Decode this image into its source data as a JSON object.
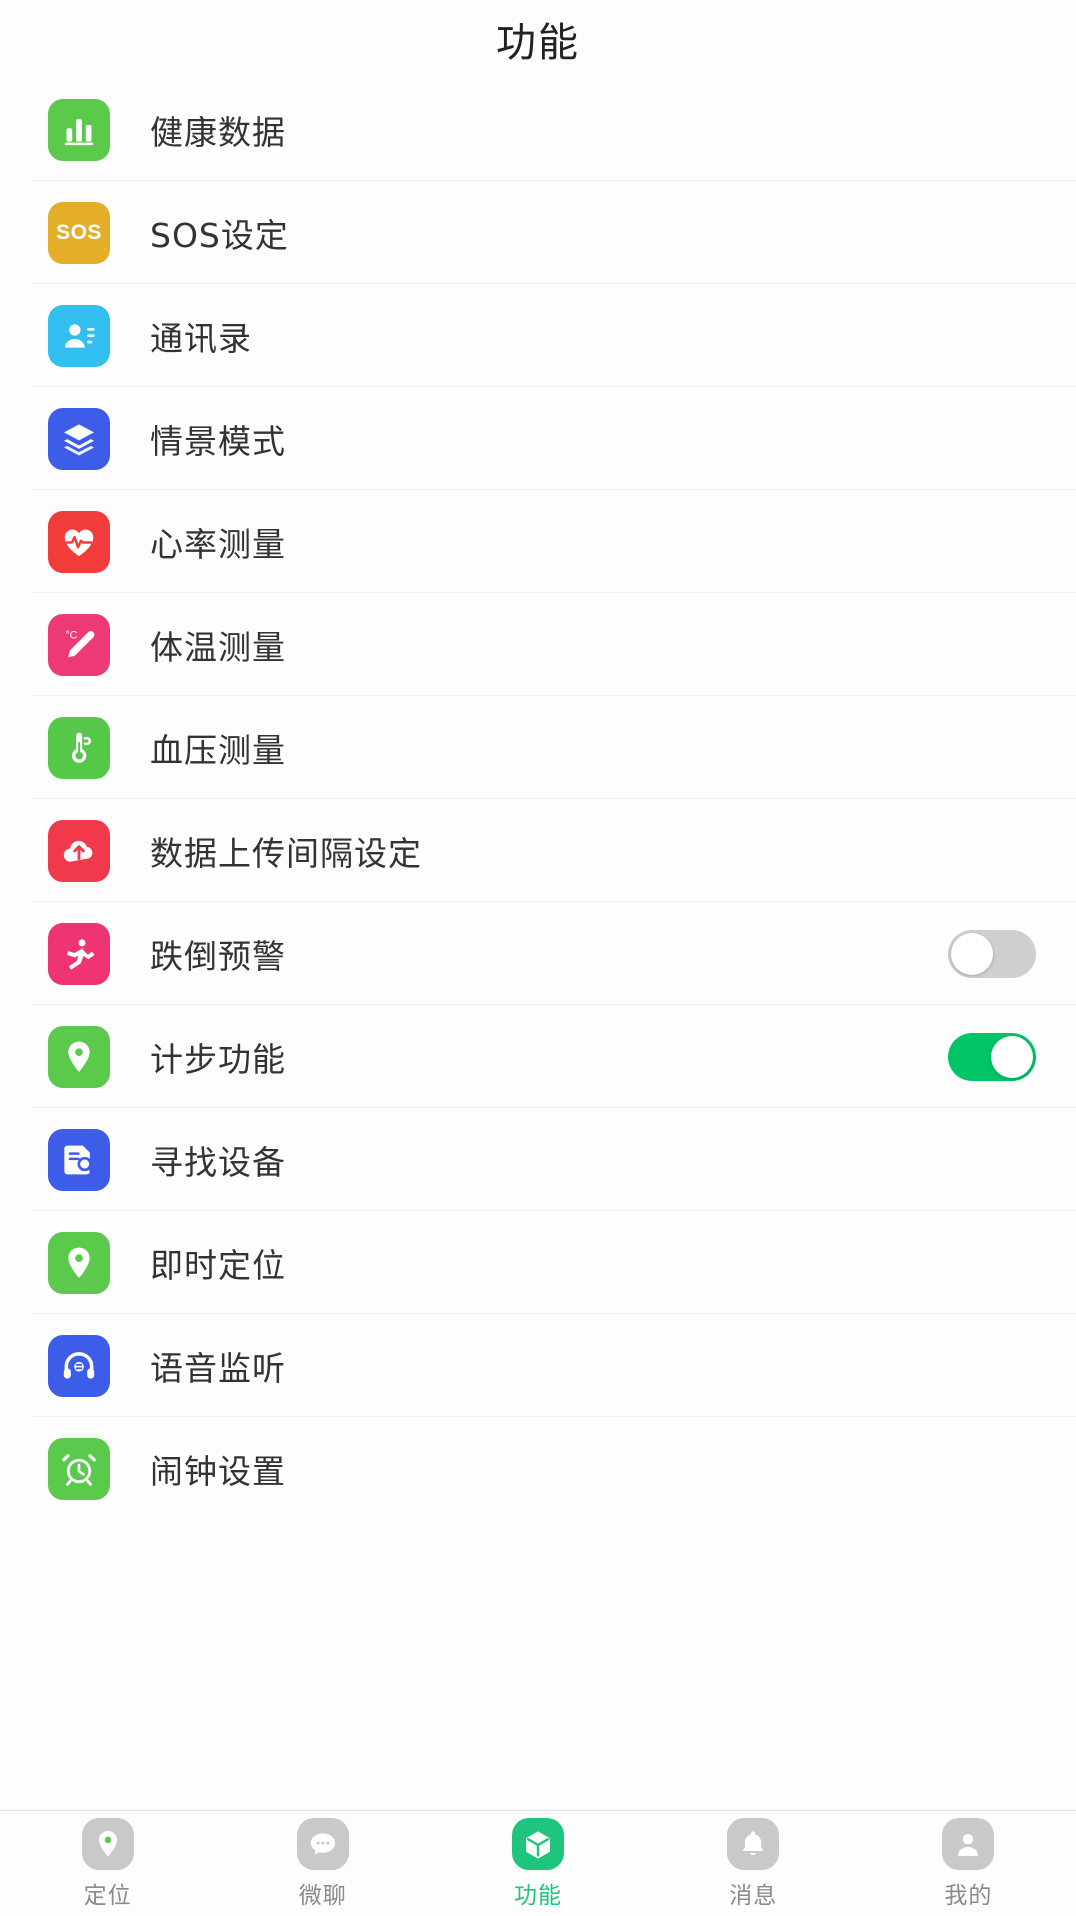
{
  "header": {
    "title": "功能"
  },
  "list": {
    "items": [
      {
        "label": "健康数据",
        "icon": "bar-chart-icon",
        "color": "#5BC94C",
        "control": "none"
      },
      {
        "label": "SOS设定",
        "icon": "sos-icon",
        "color": "#E3AE28",
        "control": "none"
      },
      {
        "label": "通讯录",
        "icon": "contacts-icon",
        "color": "#33BEF0",
        "control": "none"
      },
      {
        "label": "情景模式",
        "icon": "layers-icon",
        "color": "#3D5CE8",
        "control": "none"
      },
      {
        "label": "心率测量",
        "icon": "heart-rate-icon",
        "color": "#F23B3B",
        "control": "none"
      },
      {
        "label": "体温测量",
        "icon": "thermometer-pen-icon",
        "color": "#ED3A75",
        "control": "none"
      },
      {
        "label": "血压测量",
        "icon": "blood-pressure-icon",
        "color": "#55C84A",
        "control": "none"
      },
      {
        "label": "数据上传间隔设定",
        "icon": "cloud-upload-icon",
        "color": "#F03A4B",
        "control": "none"
      },
      {
        "label": "跌倒预警",
        "icon": "fall-alert-icon",
        "color": "#EE3572",
        "control": "toggle",
        "on": false
      },
      {
        "label": "计步功能",
        "icon": "pedometer-icon",
        "color": "#5BC94C",
        "control": "toggle",
        "on": true
      },
      {
        "label": "寻找设备",
        "icon": "find-device-icon",
        "color": "#3D5CE8",
        "control": "none"
      },
      {
        "label": "即时定位",
        "icon": "location-pin-icon",
        "color": "#5BC94C",
        "control": "none"
      },
      {
        "label": "语音监听",
        "icon": "headphones-icon",
        "color": "#3D5CE8",
        "control": "none"
      },
      {
        "label": "闹钟设置",
        "icon": "alarm-clock-icon",
        "color": "#5BC94C",
        "control": "none"
      }
    ]
  },
  "tabbar": {
    "active_index": 2,
    "active_color": "#1FC47D",
    "inactive_color": "#C9C9C9",
    "tabs": [
      {
        "label": "定位",
        "icon": "location-pin-icon"
      },
      {
        "label": "微聊",
        "icon": "chat-bubble-icon"
      },
      {
        "label": "功能",
        "icon": "cube-icon"
      },
      {
        "label": "消息",
        "icon": "bell-icon"
      },
      {
        "label": "我的",
        "icon": "person-icon"
      }
    ]
  }
}
